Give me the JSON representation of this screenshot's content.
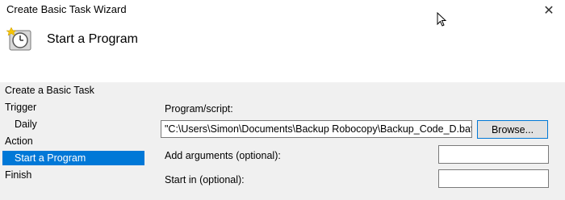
{
  "window": {
    "title": "Create Basic Task Wizard"
  },
  "header": {
    "heading": "Start a Program",
    "icon": "task-scheduler-clock-icon"
  },
  "sidebar": {
    "items": [
      {
        "label": "Create a Basic Task",
        "selected": false
      },
      {
        "label": "Trigger",
        "selected": false
      },
      {
        "label": "Daily",
        "selected": false
      },
      {
        "label": "Action",
        "selected": false
      },
      {
        "label": "Start a Program",
        "selected": true
      },
      {
        "label": "Finish",
        "selected": false
      }
    ]
  },
  "form": {
    "program_label": "Program/script:",
    "program_value": "\"C:\\Users\\Simon\\Documents\\Backup Robocopy\\Backup_Code_D.bat\"",
    "browse_label": "Browse...",
    "arguments_label": "Add arguments (optional):",
    "arguments_value": "",
    "start_in_label": "Start in (optional):",
    "start_in_value": ""
  },
  "colors": {
    "accent": "#0078d7",
    "panel_bg": "#f0f0f0"
  }
}
